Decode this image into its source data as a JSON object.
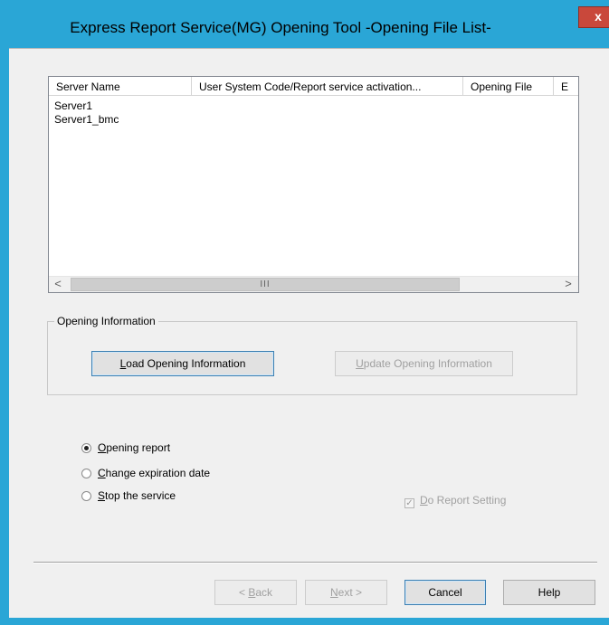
{
  "window": {
    "title": "Express Report Service(MG)  Opening Tool  -Opening File List-",
    "close_glyph": "x",
    "accent_color": "#2aa6d6"
  },
  "list": {
    "columns": [
      "Server Name",
      "User System Code/Report service activation...",
      "Opening File",
      "E"
    ],
    "rows": [
      "Server1",
      "Server1_bmc"
    ],
    "scroll_left": "<",
    "scroll_right": ">",
    "scroll_thumb": "III"
  },
  "opening_info": {
    "group_label": "Opening Information",
    "load_button": {
      "mnemonic": "L",
      "rest": "oad Opening Information"
    },
    "update_button": {
      "mnemonic": "U",
      "rest": "pdate Opening Information"
    }
  },
  "options": {
    "opening_report": {
      "mnemonic": "O",
      "rest": "pening report",
      "selected": true
    },
    "change_expiration": {
      "mnemonic": "C",
      "rest": "hange expiration date",
      "selected": false
    },
    "stop_service": {
      "mnemonic": "S",
      "rest": "top the service",
      "selected": false
    }
  },
  "do_report_setting": {
    "mnemonic": "D",
    "rest": "o Report Setting",
    "checked": true,
    "enabled": false
  },
  "footer": {
    "back": {
      "prefix": "< ",
      "mnemonic": "B",
      "rest": "ack"
    },
    "next": {
      "mnemonic": "N",
      "rest": "ext",
      "suffix": " >"
    },
    "cancel": "Cancel",
    "help": "Help"
  }
}
